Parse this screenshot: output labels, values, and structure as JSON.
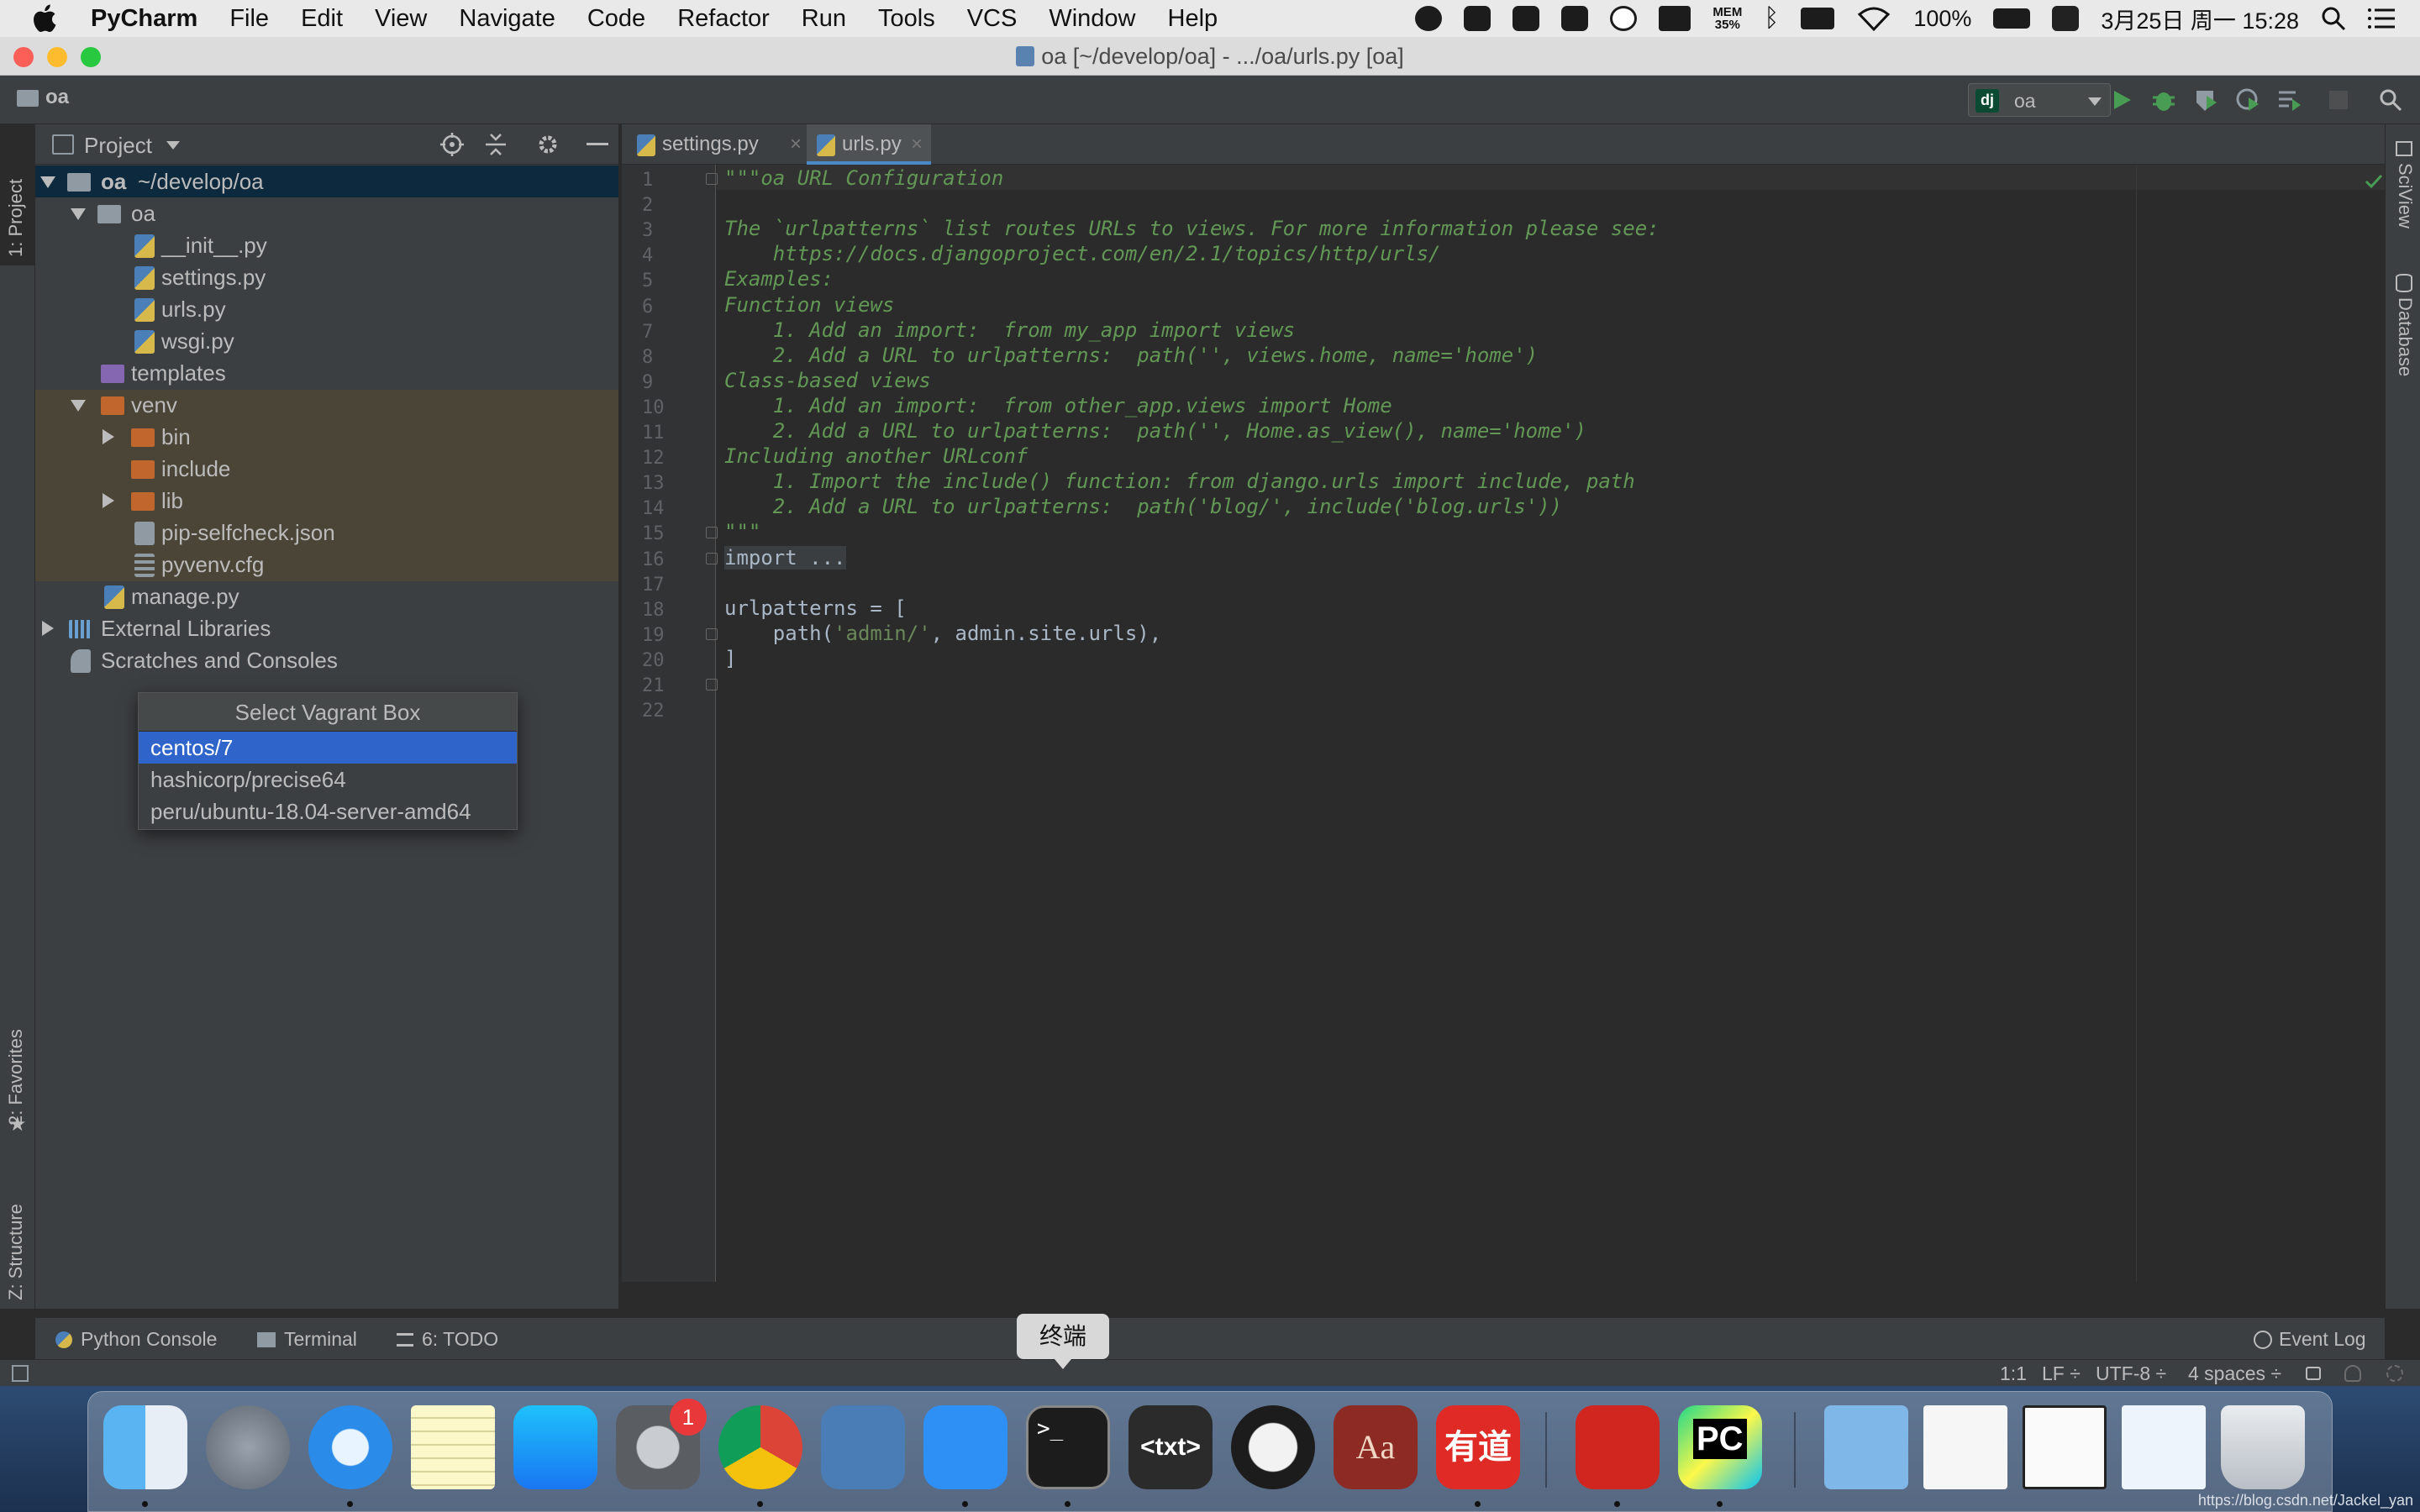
{
  "menubar": {
    "app_name": "PyCharm",
    "items": [
      "File",
      "Edit",
      "View",
      "Navigate",
      "Code",
      "Refactor",
      "Run",
      "Tools",
      "VCS",
      "Window",
      "Help"
    ],
    "mem_label": "MEM",
    "mem_value": "35%",
    "battery": "100%",
    "clock": "3月25日 周一 15:28"
  },
  "window": {
    "title": "oa [~/develop/oa] - .../oa/urls.py [oa]"
  },
  "navbar": {
    "breadcrumb": "oa",
    "run_config": "oa",
    "run_config_badge": "dj"
  },
  "left_tabs": {
    "project": "1: Project",
    "favorites": "2: Favorites",
    "structure": "Z: Structure"
  },
  "project_panel": {
    "header": "Project",
    "tree": [
      {
        "label": "oa",
        "suffix": "~/develop/oa"
      },
      {
        "label": "oa"
      },
      {
        "label": "__init__.py"
      },
      {
        "label": "settings.py"
      },
      {
        "label": "urls.py"
      },
      {
        "label": "wsgi.py"
      },
      {
        "label": "templates"
      },
      {
        "label": "venv"
      },
      {
        "label": "bin"
      },
      {
        "label": "include"
      },
      {
        "label": "lib"
      },
      {
        "label": "pip-selfcheck.json"
      },
      {
        "label": "pyvenv.cfg"
      },
      {
        "label": "manage.py"
      },
      {
        "label": "External Libraries"
      },
      {
        "label": "Scratches and Consoles"
      }
    ]
  },
  "popup": {
    "title": "Select Vagrant Box",
    "options": [
      "centos/7",
      "hashicorp/precise64",
      "peru/ubuntu-18.04-server-amd64"
    ],
    "selected": "centos/7"
  },
  "editor": {
    "tabs": [
      {
        "label": "settings.py"
      },
      {
        "label": "urls.py",
        "active": true
      }
    ],
    "line_numbers": [
      "1",
      "2",
      "3",
      "4",
      "5",
      "6",
      "7",
      "8",
      "9",
      "10",
      "11",
      "12",
      "13",
      "14",
      "15",
      "16",
      "17",
      "18",
      "19",
      "20",
      "21",
      "22"
    ],
    "lines": [
      "\"\"\"oa URL Configuration",
      "",
      "The `urlpatterns` list routes URLs to views. For more information please see:",
      "    https://docs.djangoproject.com/en/2.1/topics/http/urls/",
      "Examples:",
      "Function views",
      "    1. Add an import:  from my_app import views",
      "    2. Add a URL to urlpatterns:  path('', views.home, name='home')",
      "Class-based views",
      "    1. Add an import:  from other_app.views import Home",
      "    2. Add a URL to urlpatterns:  path('', Home.as_view(), name='home')",
      "Including another URLconf",
      "    1. Import the include() function: from django.urls import include, path",
      "    2. Add a URL to urlpatterns:  path('blog/', include('blog.urls'))",
      "\"\"\"",
      "import ...",
      "",
      "urlpatterns = [",
      "    path('admin/', admin.site.urls),",
      "]",
      "",
      ""
    ]
  },
  "right_tabs": {
    "sciview": "SciView",
    "database": "Database"
  },
  "bottom_tools": {
    "python_console": "Python Console",
    "terminal": "Terminal",
    "todo": "6: TODO",
    "event_log": "Event Log"
  },
  "statusbar": {
    "position": "1:1",
    "line_sep": "LF ÷",
    "encoding": "UTF-8 ÷",
    "indent": "4 spaces ÷"
  },
  "dock": {
    "tooltip": "终端",
    "apps": [
      "Finder",
      "Launchpad",
      "Safari",
      "Notes",
      "App Store",
      "System Preferences",
      "Chrome",
      "Tasks",
      "Markup",
      "Terminal",
      "Text Editor",
      "Activity Monitor",
      "Dictionary",
      "Youdao",
      "PDF Expert",
      "PyCharm",
      "Downloads",
      "Document",
      "Screenshot",
      "Preview",
      "Trash"
    ],
    "sysprefs_badge": "1"
  },
  "watermark": "https://blog.csdn.net/Jackel_yan",
  "colors": {
    "accent_selection": "#2f65ca",
    "docstring": "#629755",
    "string": "#6a8759",
    "code": "#a9b7c6"
  }
}
